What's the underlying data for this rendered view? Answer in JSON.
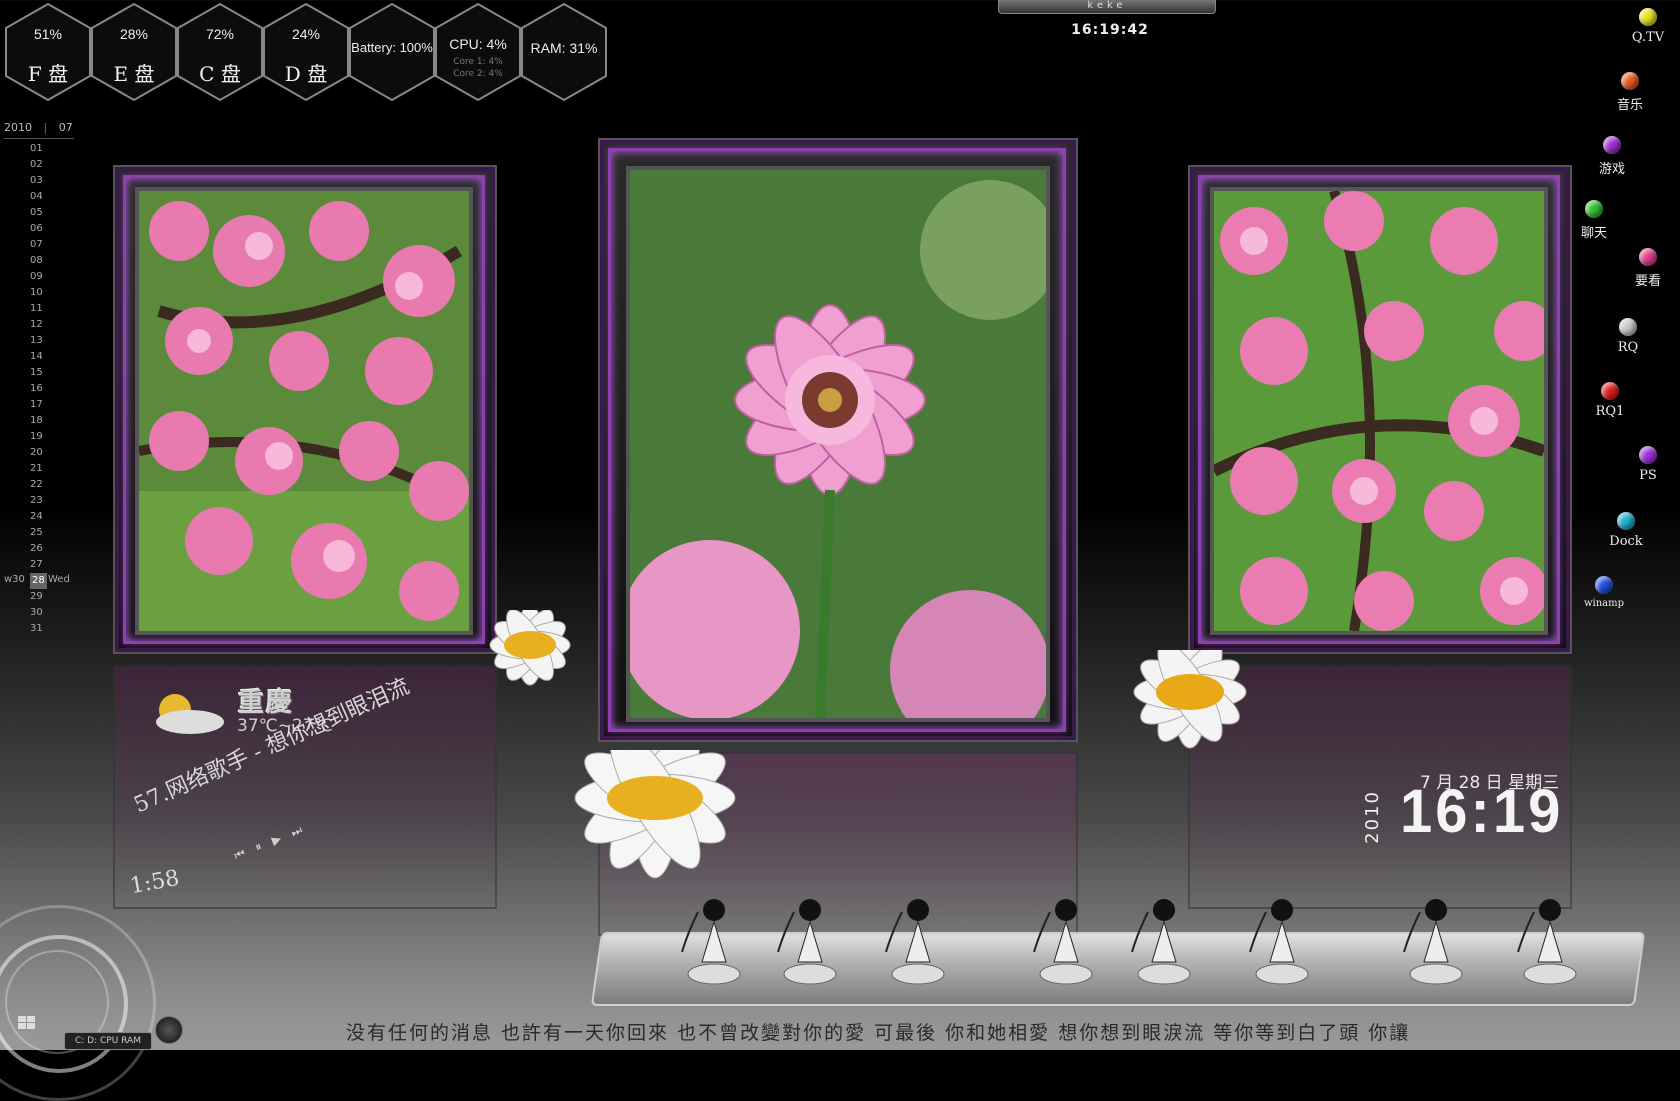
{
  "meters": [
    {
      "percent": "51%",
      "label": "F 盘"
    },
    {
      "percent": "28%",
      "label": "E 盘"
    },
    {
      "percent": "72%",
      "label": "C 盘"
    },
    {
      "percent": "24%",
      "label": "D 盘"
    },
    {
      "text": "Battery: 100%"
    },
    {
      "text": "CPU: 4%",
      "sub1": "Core 1: 4%",
      "sub2": "Core 2: 4%"
    },
    {
      "text": "RAM: 31%"
    }
  ],
  "top_clock": {
    "user": "keke",
    "time": "16:19:42"
  },
  "calendar": {
    "year": "2010",
    "month": "07",
    "days": [
      "01",
      "02",
      "03",
      "04",
      "05",
      "06",
      "07",
      "08",
      "09",
      "10",
      "11",
      "12",
      "13",
      "14",
      "15",
      "16",
      "17",
      "18",
      "19",
      "20",
      "21",
      "22",
      "23",
      "24",
      "25",
      "26",
      "27",
      "28",
      "29",
      "30",
      "31"
    ],
    "today": "28",
    "week": "w30",
    "weekday": "Wed"
  },
  "dock_right": [
    {
      "label": "Q.TV",
      "color": "#e8e020",
      "icon": "yellow-ball-icon"
    },
    {
      "label": "音乐",
      "color": "#e85a20",
      "icon": "orange-ball-icon"
    },
    {
      "label": "游戏",
      "color": "#9a30d0",
      "icon": "purple-ball-icon"
    },
    {
      "label": "聊天",
      "color": "#30c030",
      "icon": "green-ball-icon"
    },
    {
      "label": "要看",
      "color": "#e0408a",
      "icon": "pink-ball-icon"
    },
    {
      "label": "RQ",
      "color": "#c8c8c8",
      "icon": "silver-ball-icon"
    },
    {
      "label": "RQ1",
      "color": "#e02020",
      "icon": "red-ball-icon"
    },
    {
      "label": "PS",
      "color": "#a030e0",
      "icon": "violet-ball-icon"
    },
    {
      "label": "Dock",
      "color": "#20b0d0",
      "icon": "cyan-ball-icon"
    },
    {
      "label": "winamp",
      "color": "#2050e0",
      "icon": "blue-ball-icon"
    }
  ],
  "weather": {
    "city": "重慶",
    "temp": "37℃~27℃"
  },
  "music": {
    "title": "57.网络歌手 - 想你想到眼泪流",
    "time": "1:58",
    "controls": "⏮ ⏸ ▶ ⏭"
  },
  "clock": {
    "date": "7 月 28 日  星期三",
    "year": "2010",
    "time": "16:19"
  },
  "lyrics": "没有任何的消息  也許有一天你回來  也不曾改變對你的愛  可最後 你和她相愛  想你想到眼淚流  等你等到白了頭  你讓",
  "cpu_box": "C: D: CPU RAM",
  "colors": {
    "frame_accent": "#8e3fb0",
    "background": "#000000"
  }
}
